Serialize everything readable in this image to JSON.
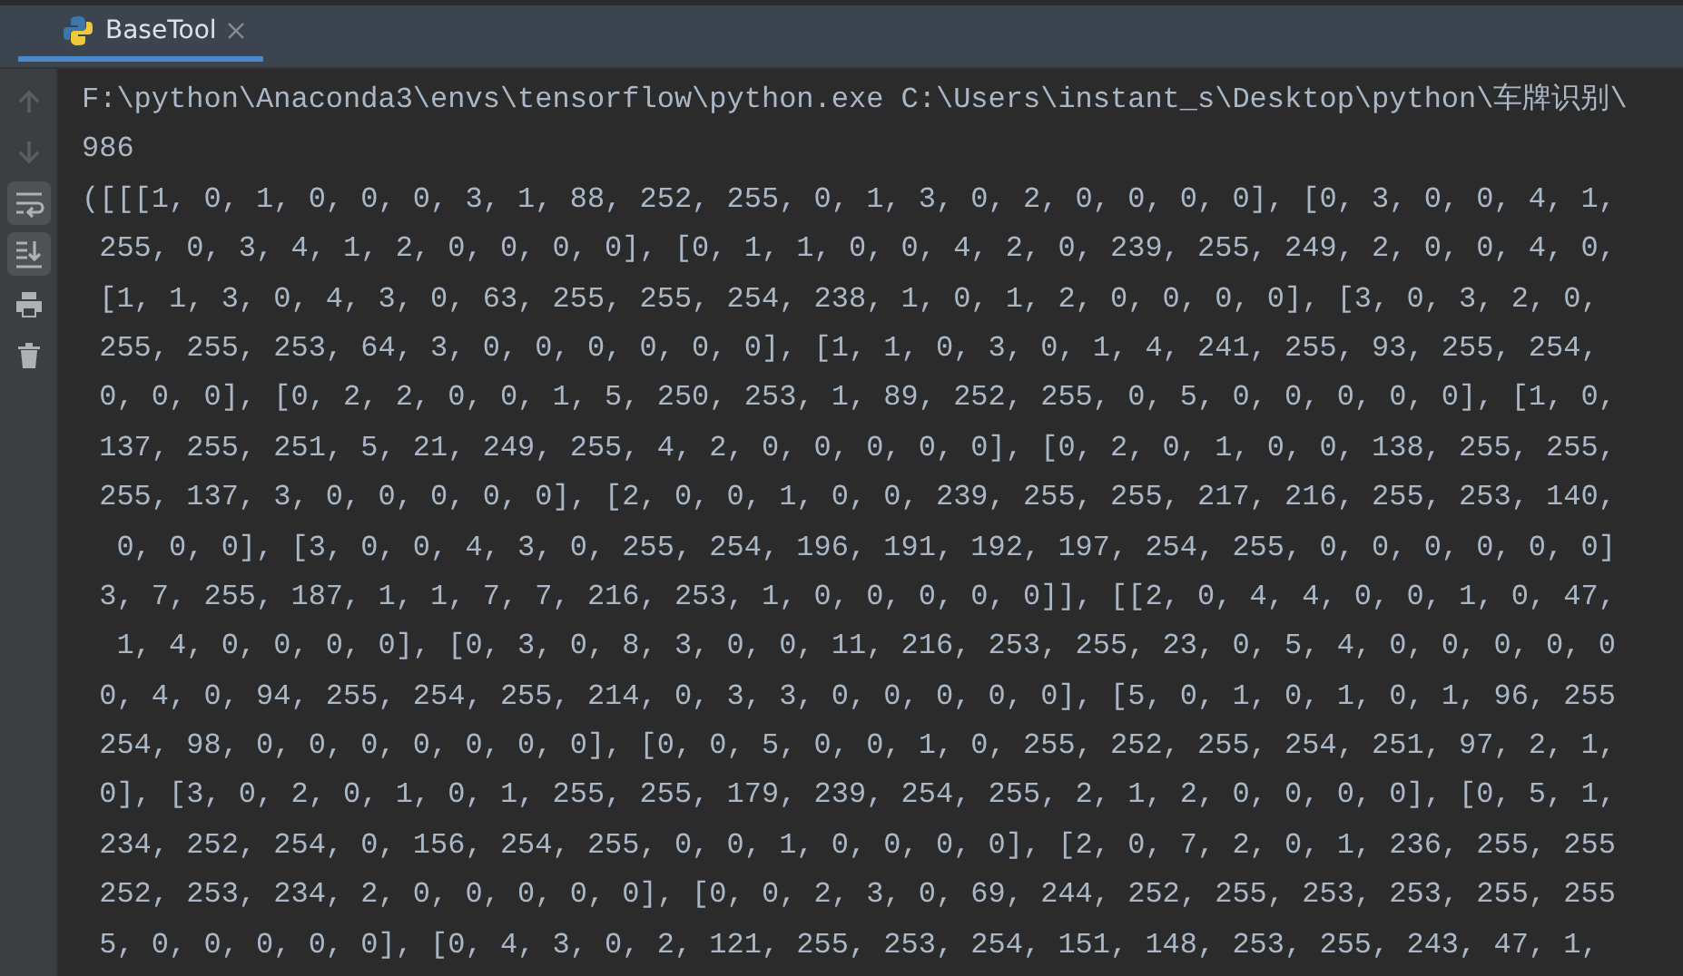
{
  "tab": {
    "title": "BaseTool",
    "selected": true
  },
  "toolbar": [
    {
      "kind": "up",
      "disabled": true,
      "on": false
    },
    {
      "kind": "down",
      "disabled": true,
      "on": false
    },
    {
      "kind": "wrap",
      "disabled": false,
      "on": true
    },
    {
      "kind": "scroll-end",
      "disabled": false,
      "on": true
    },
    {
      "kind": "print",
      "disabled": false,
      "on": false
    },
    {
      "kind": "trash",
      "disabled": false,
      "on": false
    }
  ],
  "console": {
    "lines": [
      "F:\\python\\Anaconda3\\envs\\tensorflow\\python.exe C:\\Users\\instant_s\\Desktop\\python\\车牌识别\\",
      "986",
      "([[[1, 0, 1, 0, 0, 0, 3, 1, 88, 252, 255, 0, 1, 3, 0, 2, 0, 0, 0, 0], [0, 3, 0, 0, 4, 1,",
      " 255, 0, 3, 4, 1, 2, 0, 0, 0, 0], [0, 1, 1, 0, 0, 4, 2, 0, 239, 255, 249, 2, 0, 0, 4, 0,",
      " [1, 1, 3, 0, 4, 3, 0, 63, 255, 255, 254, 238, 1, 0, 1, 2, 0, 0, 0, 0], [3, 0, 3, 2, 0,",
      " 255, 255, 253, 64, 3, 0, 0, 0, 0, 0, 0], [1, 1, 0, 3, 0, 1, 4, 241, 255, 93, 255, 254,",
      " 0, 0, 0], [0, 2, 2, 0, 0, 1, 5, 250, 253, 1, 89, 252, 255, 0, 5, 0, 0, 0, 0, 0], [1, 0,",
      " 137, 255, 251, 5, 21, 249, 255, 4, 2, 0, 0, 0, 0, 0], [0, 2, 0, 1, 0, 0, 138, 255, 255,",
      " 255, 137, 3, 0, 0, 0, 0, 0], [2, 0, 0, 1, 0, 0, 239, 255, 255, 217, 216, 255, 253, 140,",
      "  0, 0, 0], [3, 0, 0, 4, 3, 0, 255, 254, 196, 191, 192, 197, 254, 255, 0, 0, 0, 0, 0, 0]",
      " 3, 7, 255, 187, 1, 1, 7, 7, 216, 253, 1, 0, 0, 0, 0, 0]], [[2, 0, 4, 4, 0, 0, 1, 0, 47,",
      "  1, 4, 0, 0, 0, 0], [0, 3, 0, 8, 3, 0, 0, 11, 216, 253, 255, 23, 0, 5, 4, 0, 0, 0, 0, 0",
      " 0, 4, 0, 94, 255, 254, 255, 214, 0, 3, 3, 0, 0, 0, 0, 0], [5, 0, 1, 0, 1, 0, 1, 96, 255",
      " 254, 98, 0, 0, 0, 0, 0, 0, 0], [0, 0, 5, 0, 0, 1, 0, 255, 252, 255, 254, 251, 97, 2, 1,",
      " 0], [3, 0, 2, 0, 1, 0, 1, 255, 255, 179, 239, 254, 255, 2, 1, 2, 0, 0, 0, 0], [0, 5, 1,",
      " 234, 252, 254, 0, 156, 254, 255, 0, 0, 1, 0, 0, 0, 0], [2, 0, 7, 2, 0, 1, 236, 255, 255",
      " 252, 253, 234, 2, 0, 0, 0, 0, 0], [0, 0, 2, 3, 0, 69, 244, 252, 255, 253, 253, 255, 255",
      " 5, 0, 0, 0, 0, 0], [0, 4, 3, 0, 2, 121, 255, 253, 254, 151, 148, 253, 255, 243, 47, 1,"
    ]
  }
}
